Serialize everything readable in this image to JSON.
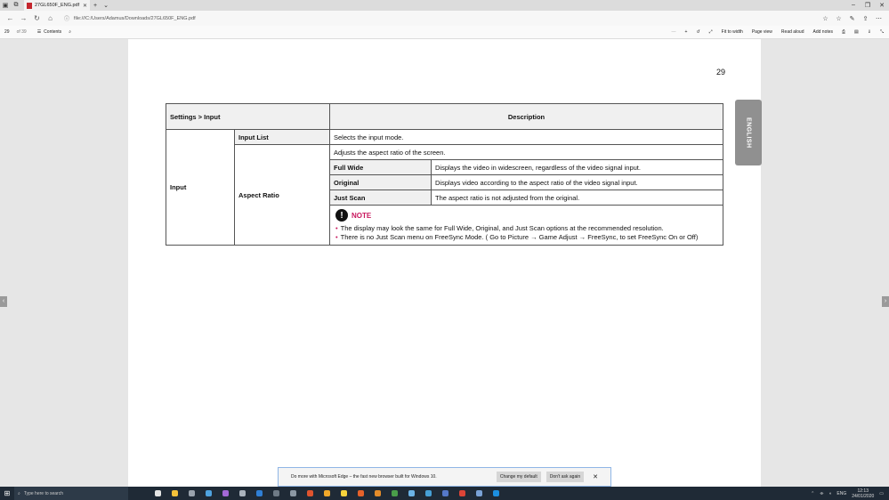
{
  "browser": {
    "tab_title": "27GL650F_ENG.pdf",
    "url": "file:///C:/Users/Adamus/Downloads/27GL650F_ENG.pdf"
  },
  "pdf_toolbar": {
    "page_number": "29",
    "page_total": "of 39",
    "contents_label": "Contents",
    "fit_to_width": "Fit to width",
    "page_view": "Page view",
    "read_aloud": "Read aloud",
    "add_notes": "Add notes"
  },
  "document": {
    "page_number": "29",
    "side_tab": "ENGLISH",
    "table": {
      "header_left": "Settings > Input",
      "header_right": "Description",
      "row_label": "Input",
      "input_list_label": "Input List",
      "input_list_desc": "Selects the input mode.",
      "aspect_label": "Aspect Ratio",
      "aspect_desc": "Adjusts the aspect ratio of the screen.",
      "options": [
        {
          "name": "Full Wide",
          "desc": "Displays the video in widescreen, regardless of the video signal input."
        },
        {
          "name": "Original",
          "desc": "Displays video according to the aspect ratio of the video signal input."
        },
        {
          "name": "Just Scan",
          "desc": "The aspect ratio is not adjusted from the original."
        }
      ],
      "note": {
        "title": "NOTE",
        "line1": "The display may look the same for Full Wide, Original, and Just Scan options at the recommended resolution.",
        "line2": "There is no Just Scan menu on FreeSync Mode.  ( Go to Picture → Game Adjust → FreeSync, to set FreeSync On or Off)"
      }
    }
  },
  "banner": {
    "message": "Do more with Microsoft Edge – the fast new browser built for Windows 10.",
    "change_default": "Change my default",
    "dont_ask": "Don't ask again"
  },
  "taskbar": {
    "search_placeholder": "Type here to search",
    "lang": "ENG",
    "time": "12:13",
    "date": "24/01/2020",
    "app_colors": [
      "#e5e5e5",
      "#f3c13a",
      "#9aa3ad",
      "#4fa3e0",
      "#a368d6",
      "#aab3bd",
      "#2f7fd5",
      "#6e7a86",
      "#8c98a4",
      "#e0542e",
      "#f0a82a",
      "#f7d33c",
      "#e6622a",
      "#e48c2a",
      "#4a9e4a",
      "#6bb3e6",
      "#46a0d6",
      "#5578c8",
      "#db4437",
      "#7aa2d6",
      "#1c8fe0"
    ]
  }
}
